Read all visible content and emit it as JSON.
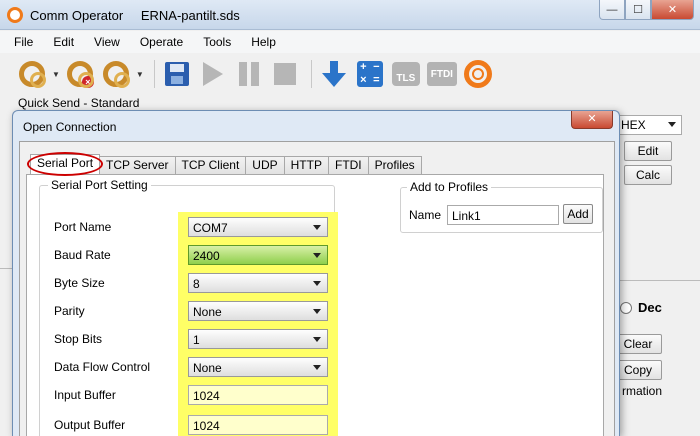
{
  "window": {
    "app_title": "Comm Operator",
    "document_title": "ERNA-pantilt.sds",
    "minimize_glyph": "—",
    "maximize_glyph": "☐",
    "close_glyph": "✕"
  },
  "menu": [
    "File",
    "Edit",
    "View",
    "Operate",
    "Tools",
    "Help"
  ],
  "toolbar": {
    "icons": [
      "connect-icon",
      "disconnect-icon",
      "connect-all-icon",
      "save-icon",
      "play-icon",
      "pause-icon",
      "stop-icon",
      "download-icon",
      "calculator-icon",
      "tls-icon",
      "ftdi-icon",
      "logo-icon"
    ],
    "tls_text": "TLS",
    "ftdi_text": "FTDI",
    "dropdown_glyph": "▼"
  },
  "quick_send_label": "Quick Send - Standard",
  "right_panel": {
    "format_select": "HEX",
    "edit_button": "Edit",
    "calc_button": "Calc",
    "dec_label": "Dec",
    "clear_button": "Clear",
    "copy_button": "Copy",
    "info_text": "rmation"
  },
  "dialog": {
    "title": "Open Connection",
    "close_glyph": "✕",
    "tabs": [
      "Serial Port",
      "TCP Server",
      "TCP Client",
      "UDP",
      "HTTP",
      "FTDI",
      "Profiles"
    ],
    "active_tab": "Serial Port",
    "serial_group": {
      "legend": "Serial Port Setting",
      "fields": [
        {
          "label": "Port Name",
          "value": "COM7",
          "kind": "combo"
        },
        {
          "label": "Baud Rate",
          "value": "2400",
          "kind": "combo"
        },
        {
          "label": "Byte Size",
          "value": "8",
          "kind": "combo"
        },
        {
          "label": "Parity",
          "value": "None",
          "kind": "combo"
        },
        {
          "label": "Stop Bits",
          "value": "1",
          "kind": "combo"
        },
        {
          "label": "Data Flow Control",
          "value": "None",
          "kind": "combo"
        },
        {
          "label": "Input Buffer",
          "value": "1024",
          "kind": "text"
        },
        {
          "label": "Output Buffer",
          "value": "1024",
          "kind": "text"
        }
      ]
    },
    "profiles_group": {
      "legend": "Add to Profiles",
      "name_label": "Name",
      "name_value": "Link1",
      "add_button": "Add"
    }
  },
  "colors": {
    "highlight": "#ffff66",
    "baud_selected": "#8fcf4c",
    "tab_ring": "#cc0000",
    "brand_orange": "#f07a1a"
  }
}
